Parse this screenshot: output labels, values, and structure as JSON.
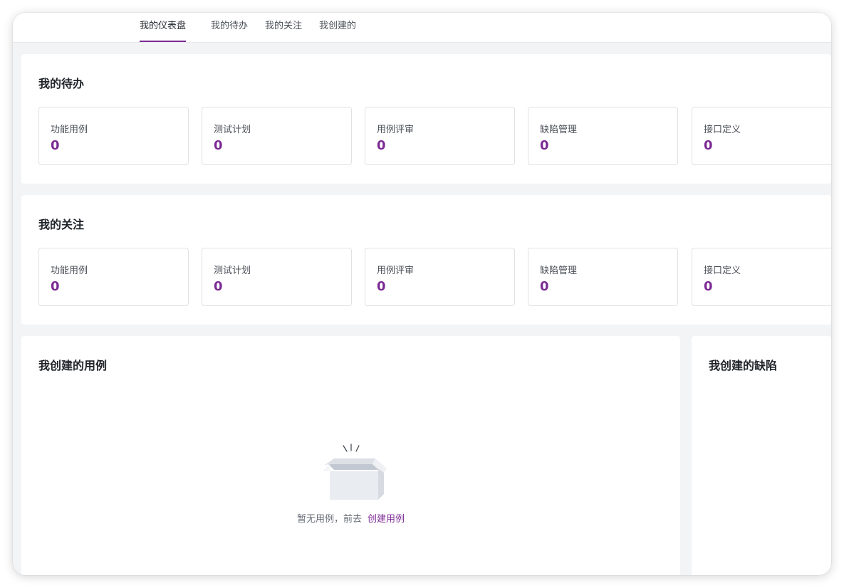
{
  "tabs": [
    {
      "label": "我的仪表盘",
      "active": true
    },
    {
      "label": "我的待办",
      "active": false
    },
    {
      "label": "我的关注",
      "active": false
    },
    {
      "label": "我创建的",
      "active": false
    }
  ],
  "todo": {
    "title": "我的待办",
    "cards": [
      {
        "label": "功能用例",
        "value": "0"
      },
      {
        "label": "测试计划",
        "value": "0"
      },
      {
        "label": "用例评审",
        "value": "0"
      },
      {
        "label": "缺陷管理",
        "value": "0"
      },
      {
        "label": "接口定义",
        "value": "0"
      }
    ]
  },
  "follow": {
    "title": "我的关注",
    "cards": [
      {
        "label": "功能用例",
        "value": "0"
      },
      {
        "label": "测试计划",
        "value": "0"
      },
      {
        "label": "用例评审",
        "value": "0"
      },
      {
        "label": "缺陷管理",
        "value": "0"
      },
      {
        "label": "接口定义",
        "value": "0"
      }
    ]
  },
  "created_cases": {
    "title": "我创建的用例",
    "empty_text": "暂无用例，前去",
    "create_link": "创建用例",
    "empty_icon": "empty-box-icon"
  },
  "created_bugs": {
    "title": "我创建的缺陷"
  },
  "colors": {
    "accent": "#7b2a93",
    "background": "#f3f4f6",
    "card_border": "#dfe1e5"
  }
}
